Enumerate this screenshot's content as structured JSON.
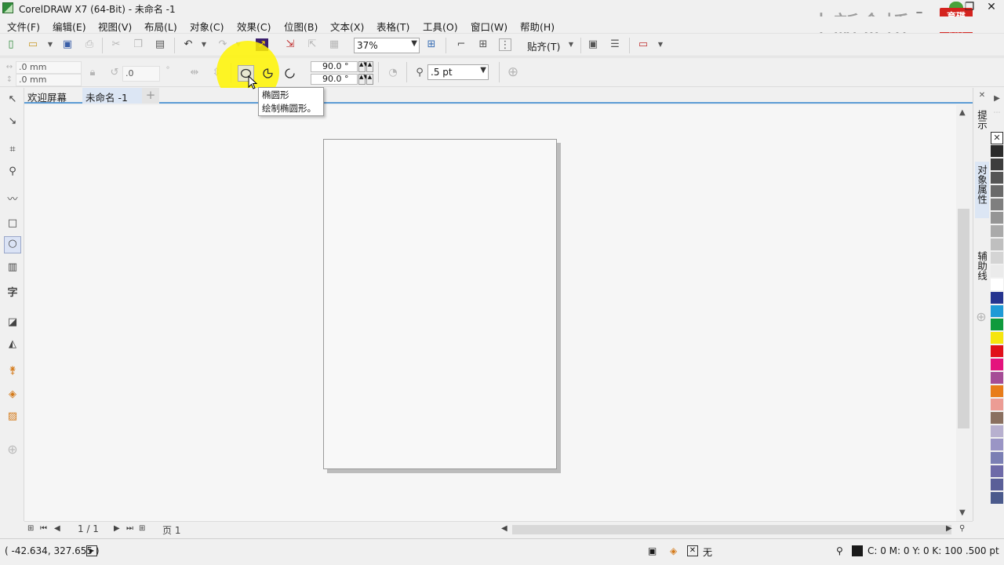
{
  "window": {
    "title": "CorelDRAW X7 (64-Bit) - 未命名 -1",
    "minimize_label": "_",
    "restore_label": "❐",
    "close_label": "✕"
  },
  "watermark": {
    "text": "中新金桥",
    "logo_text": "育碟软件"
  },
  "menu": {
    "items": [
      {
        "label": "文件(F)"
      },
      {
        "label": "编辑(E)"
      },
      {
        "label": "视图(V)"
      },
      {
        "label": "布局(L)"
      },
      {
        "label": "对象(C)"
      },
      {
        "label": "效果(C)"
      },
      {
        "label": "位图(B)"
      },
      {
        "label": "文本(X)"
      },
      {
        "label": "表格(T)"
      },
      {
        "label": "工具(O)"
      },
      {
        "label": "窗口(W)"
      },
      {
        "label": "帮助(H)"
      }
    ]
  },
  "toolbar": {
    "zoom_value": "37%",
    "snap_label": "贴齐(T)"
  },
  "propbar": {
    "x_value": ".0 mm",
    "y_value": ".0 mm",
    "angle_value": ".0",
    "angle_unit": "°",
    "start_angle": "90.0 °",
    "end_angle": "90.0 °",
    "outline_width": ".5 pt"
  },
  "tooltip": {
    "title": "椭圆形",
    "description": "绘制椭圆形。"
  },
  "tabs": {
    "welcome": "欢迎屏幕",
    "document": "未命名 -1",
    "add": "+"
  },
  "docker": {
    "tabs": [
      "提示",
      "对象属性",
      "辅助线"
    ]
  },
  "palette": {
    "colors": [
      "#2b2b2b",
      "#3d3d3d",
      "#555555",
      "#6a6a6a",
      "#7f7f7f",
      "#959595",
      "#aaaaaa",
      "#bfbfbf",
      "#d4d4d4",
      "#ebebeb",
      "#ffffff",
      "#25348f",
      "#1e9ad6",
      "#0f9a3c",
      "#f6e50e",
      "#e1101a",
      "#e4137d",
      "#a54c96",
      "#e87c1a",
      "#ec9c94",
      "#8a7060",
      "#b7b0cf",
      "#9a95c5",
      "#7b7fb4",
      "#6e6aa8",
      "#5a5f98",
      "#4b5a8c"
    ]
  },
  "pagebar": {
    "page_count": "1 / 1",
    "page_tab": "页 1"
  },
  "status": {
    "coordinates": "( -42.634, 327.655 )",
    "fill_label": "无",
    "outline_info": "C: 0 M: 0 Y: 0 K: 100  .500 pt"
  }
}
